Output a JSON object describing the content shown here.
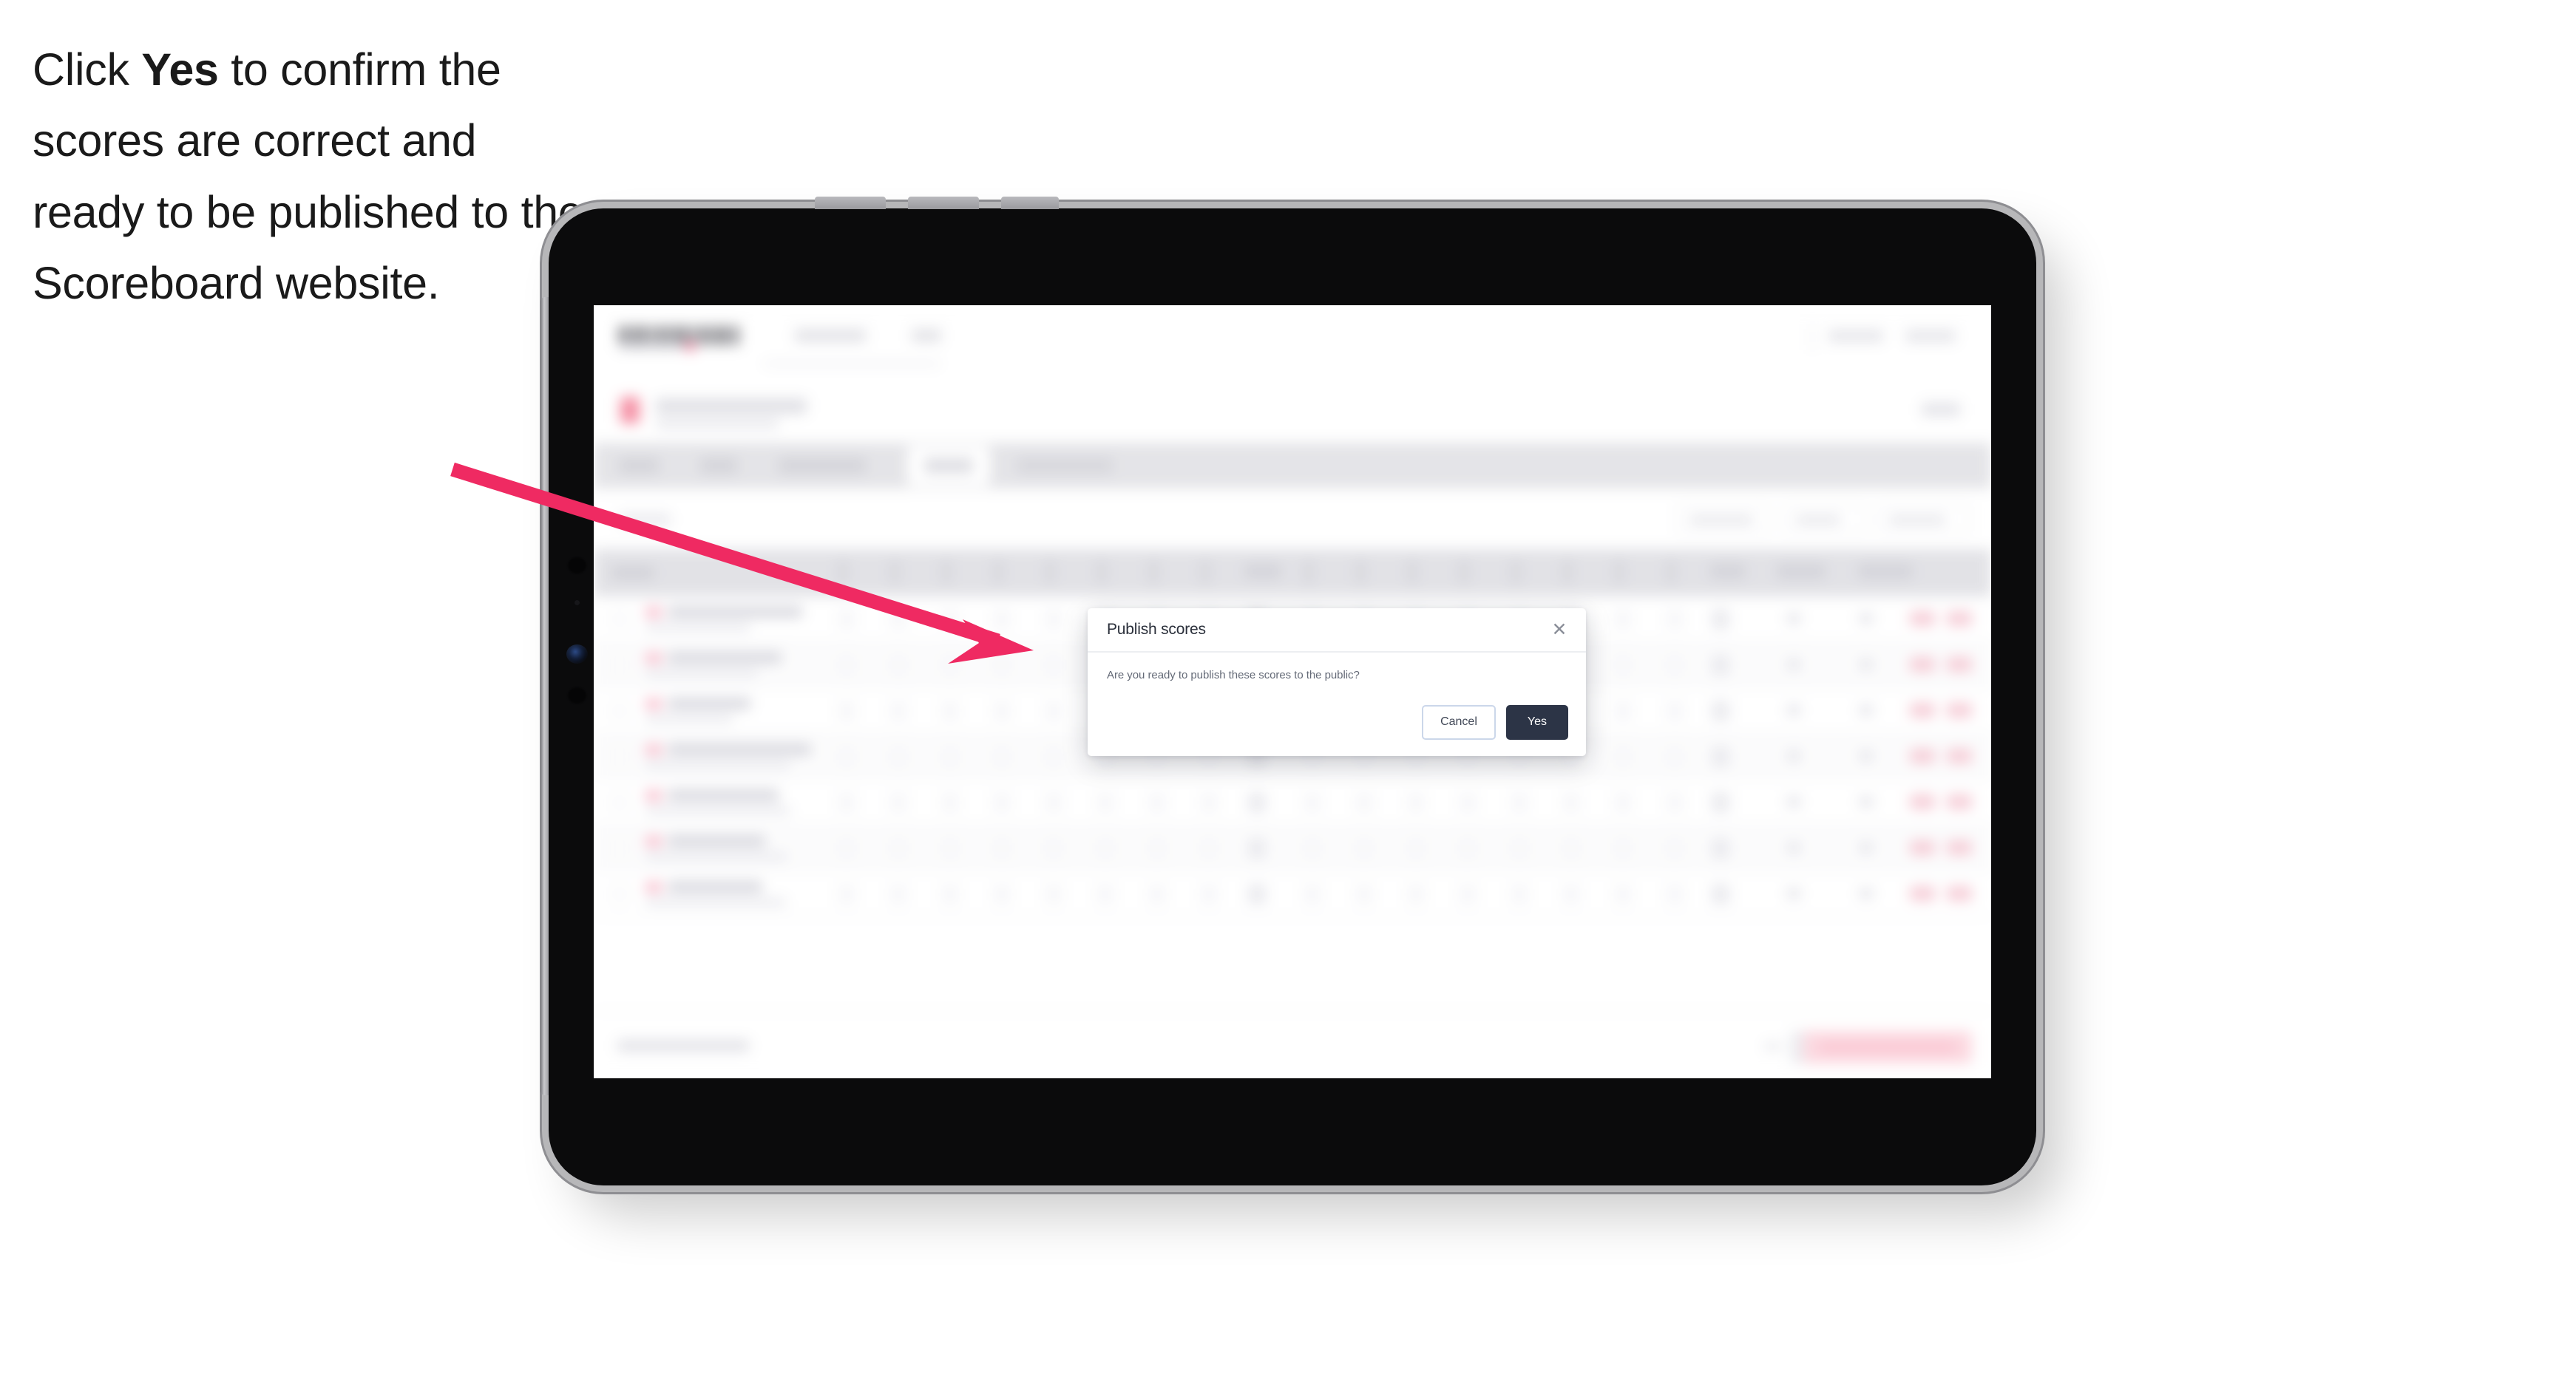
{
  "instruction": {
    "before": "Click ",
    "emphasis": "Yes",
    "after": " to confirm the scores are correct and ready to be published to the Scoreboard website."
  },
  "device": {
    "type": "tablet",
    "orientation": "landscape"
  },
  "modal": {
    "title": "Publish scores",
    "message": "Are you ready to publish these scores to the public?",
    "close_icon": "close-icon",
    "close_glyph": "✕",
    "buttons": {
      "cancel": "Cancel",
      "confirm": "Yes"
    },
    "colors": {
      "confirm_bg": "#2c3446",
      "confirm_text": "#ffffff",
      "cancel_border": "#cbd7ea",
      "cancel_text": "#404756",
      "title_text": "#2a2f3a",
      "message_text": "#646a77",
      "surface": "#ffffff"
    }
  },
  "annotation": {
    "arrow_color": "#ef2a62",
    "arrow_points_to": "Yes"
  },
  "background_app": {
    "state": "blurred",
    "description": "Scoreboard results table behind a modal overlay",
    "accent_pink": "#f1627f",
    "tab_bar_bg": "#d9d9de",
    "table_header_bg": "#d6d6dc"
  }
}
